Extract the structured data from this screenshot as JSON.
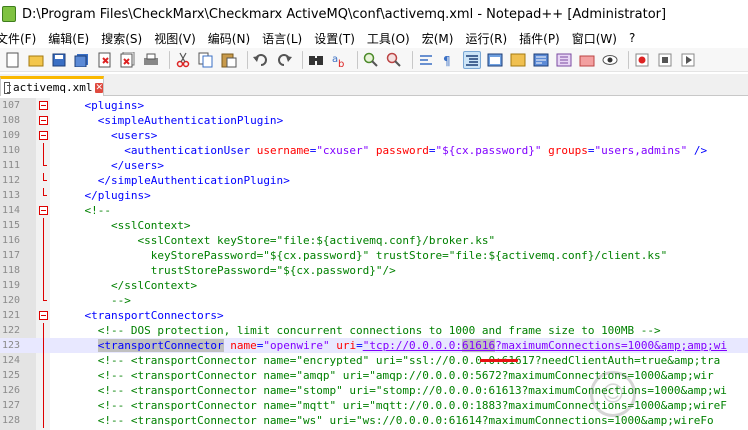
{
  "window": {
    "title": "D:\\Program Files\\CheckMarx\\Checkmarx ActiveMQ\\conf\\activemq.xml - Notepad++ [Administrator]"
  },
  "menu": [
    "文件(F)",
    "编辑(E)",
    "搜索(S)",
    "视图(V)",
    "编码(N)",
    "语言(L)",
    "设置(T)",
    "工具(O)",
    "宏(M)",
    "运行(R)",
    "插件(P)",
    "窗口(W)",
    "?"
  ],
  "toolbar": [
    "new-file-icon",
    "open-file-icon",
    "save-icon",
    "save-all-icon",
    "close-icon",
    "close-all-icon",
    "print-icon",
    "cut-icon",
    "copy-icon",
    "paste-icon",
    "undo-icon",
    "redo-icon",
    "find-icon",
    "replace-icon",
    "zoom-in-icon",
    "zoom-out-icon",
    "sync-scroll-icon",
    "word-wrap-icon",
    "show-all-chars-icon",
    "indent-guide-icon",
    "udl-icon",
    "doc-map-icon",
    "function-list-icon",
    "folder-workspace-icon",
    "monitoring-icon",
    "record-macro-icon",
    "stop-macro-icon",
    "play-macro-icon"
  ],
  "tab": {
    "label": "activemq.xml"
  },
  "lines": [
    {
      "n": "107",
      "text": "    <plugins>"
    },
    {
      "n": "108",
      "text": "      <simpleAuthenticationPlugin>"
    },
    {
      "n": "109",
      "text": "        <users>"
    },
    {
      "n": "110",
      "text": "          <authenticationUser username=\"cxuser\" password=\"${cx.password}\" groups=\"users,admins\" />"
    },
    {
      "n": "111",
      "text": "        </users>"
    },
    {
      "n": "112",
      "text": "      </simpleAuthenticationPlugin>"
    },
    {
      "n": "113",
      "text": "    </plugins>"
    },
    {
      "n": "114",
      "text": "    <!--"
    },
    {
      "n": "115",
      "text": "        <sslContext>"
    },
    {
      "n": "116",
      "text": "            <sslContext keyStore=\"file:${activemq.conf}/broker.ks\""
    },
    {
      "n": "117",
      "text": "              keyStorePassword=\"${cx.password}\" trustStore=\"file:${activemq.conf}/client.ks\""
    },
    {
      "n": "118",
      "text": "              trustStorePassword=\"${cx.password}\"/>"
    },
    {
      "n": "119",
      "text": "        </sslContext>"
    },
    {
      "n": "120",
      "text": "        -->"
    },
    {
      "n": "121",
      "text": "    <transportConnectors>"
    },
    {
      "n": "122",
      "text": "      <!-- DOS protection, limit concurrent connections to 1000 and frame size to 100MB -->"
    },
    {
      "n": "123",
      "text": "      <transportConnector name=\"openwire\" uri=\"tcp://0.0.0.0:61616?maximumConnections=1000&amp;amp;wi"
    },
    {
      "n": "124",
      "text": "      <!-- <transportConnector name=\"encrypted\" uri=\"ssl://0.0.0.0:61617?needClientAuth=true&amp;tra"
    },
    {
      "n": "125",
      "text": "      <!-- <transportConnector name=\"amqp\" uri=\"amqp://0.0.0.0:5672?maximumConnections=1000&amp;wir"
    },
    {
      "n": "126",
      "text": "      <!-- <transportConnector name=\"stomp\" uri=\"stomp://0.0.0.0:61613?maximumConnections=1000&amp;wi"
    },
    {
      "n": "127",
      "text": "      <!-- <transportConnector name=\"mqtt\" uri=\"mqtt://0.0.0.0:1883?maximumConnections=1000&amp;wireF"
    },
    {
      "n": "128",
      "text": "      <!-- <transportConnector name=\"ws\" uri=\"ws://0.0.0.0:61614?maximumConnections=1000&amp;wireFo"
    }
  ],
  "colors": {
    "tag": "#0000ff",
    "attribute": "#ff0000",
    "value": "#8000ff",
    "comment": "#008000",
    "fold_marker": "#dd0000",
    "annotation": "#e81010"
  }
}
